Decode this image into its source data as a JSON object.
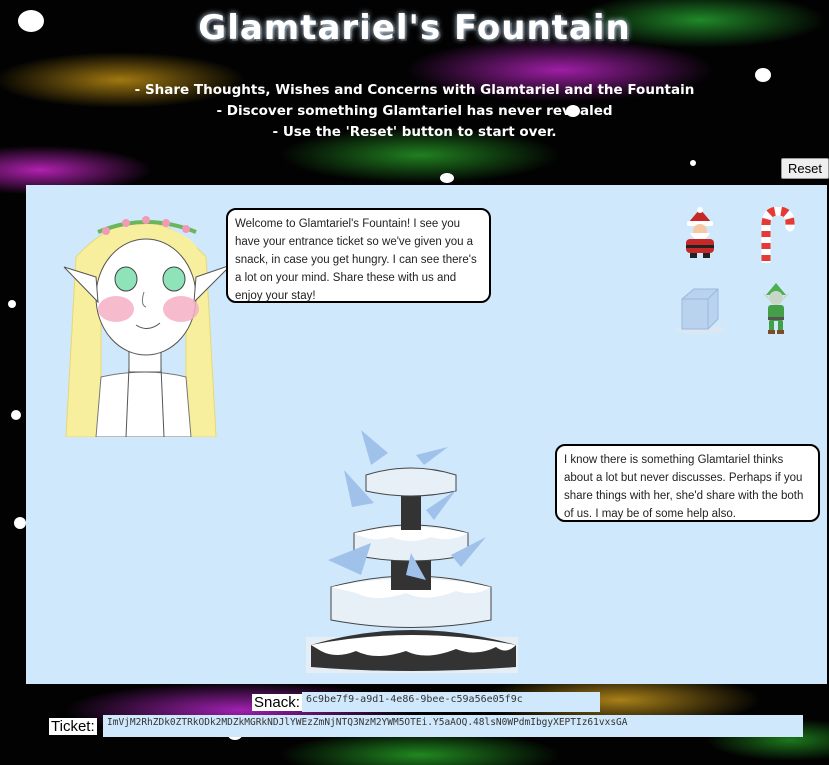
{
  "header": {
    "title": "Glamtariel's Fountain",
    "instructions": [
      "- Share Thoughts, Wishes and Concerns with Glamtariel and the Fountain",
      "- Discover something Glamtariel has never revealed",
      "- Use the 'Reset' button to start over."
    ]
  },
  "controls": {
    "reset_label": "Reset"
  },
  "dialogue": {
    "glamtariel": "Welcome to Glamtariel's Fountain! I see you have your entrance ticket so we've given you a snack, in case you get hungry. I can see there's a lot on your mind. Share these with us and enjoy your stay!",
    "fountain": "I know there is something Glamtariel thinks about a lot but never discusses. Perhaps if you share things with her, she'd share with the both of us. I may be of some help also."
  },
  "items": [
    {
      "name": "santa",
      "icon": "santa-icon"
    },
    {
      "name": "candy cane",
      "icon": "candy-cane-icon"
    },
    {
      "name": "ice cube",
      "icon": "ice-cube-icon"
    },
    {
      "name": "elf",
      "icon": "elf-icon"
    }
  ],
  "fields": {
    "snack_label": "Snack:",
    "snack_value": "6c9be7f9-a9d1-4e86-9bee-c59a56e05f9c",
    "ticket_label": "Ticket:",
    "ticket_value": "ImVjM2RhZDk0ZTRkODk2MDZkMGRkNDJlYWEzZmNjNTQ3NzM2YWM5OTEi.Y5aAOQ.48lsN0WPdmIbgyXEPTIz61vxsGA"
  },
  "colors": {
    "stage_bg": "#cfe8fb",
    "page_bg": "#000000"
  }
}
